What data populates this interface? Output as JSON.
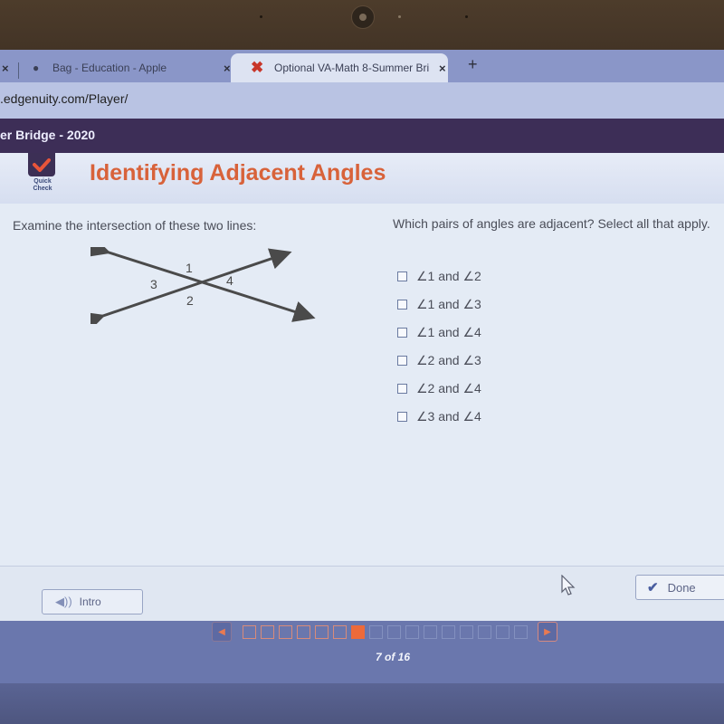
{
  "browser": {
    "tabs": [
      {
        "label": "Bag - Education - Apple",
        "icon": "apple-icon",
        "active": false
      },
      {
        "label": "Optional VA-Math 8-Summer Bri",
        "icon": "edgenuity-x-icon",
        "active": true
      }
    ],
    "close_glyph": "×",
    "new_tab_glyph": "+",
    "url": ".edgenuity.com/Player/"
  },
  "course": {
    "title": "er Bridge - 2020"
  },
  "lesson": {
    "badge_label_line1": "Quick",
    "badge_label_line2": "Check",
    "title": "Identifying Adjacent Angles"
  },
  "problem": {
    "prompt": "Examine the intersection of these two lines:",
    "diagram_labels": {
      "angle1": "1",
      "angle2": "2",
      "angle3": "3",
      "angle4": "4"
    },
    "question": "Which pairs of angles are adjacent? Select all that apply.",
    "options": [
      {
        "label": "∠1 and ∠2",
        "checked": false
      },
      {
        "label": "∠1 and ∠3",
        "checked": false
      },
      {
        "label": "∠1 and ∠4",
        "checked": false
      },
      {
        "label": "∠2 and ∠3",
        "checked": false
      },
      {
        "label": "∠2 and ∠4",
        "checked": false
      },
      {
        "label": "∠3 and ∠4",
        "checked": false
      }
    ]
  },
  "footer": {
    "intro_label": "Intro",
    "done_label": "Done",
    "progress": {
      "current": 7,
      "total": 16,
      "text": "7 of 16"
    }
  },
  "colors": {
    "accent_orange": "#ed6a3a",
    "title_orange": "#d8623a",
    "course_bar": "#3d2e57"
  }
}
